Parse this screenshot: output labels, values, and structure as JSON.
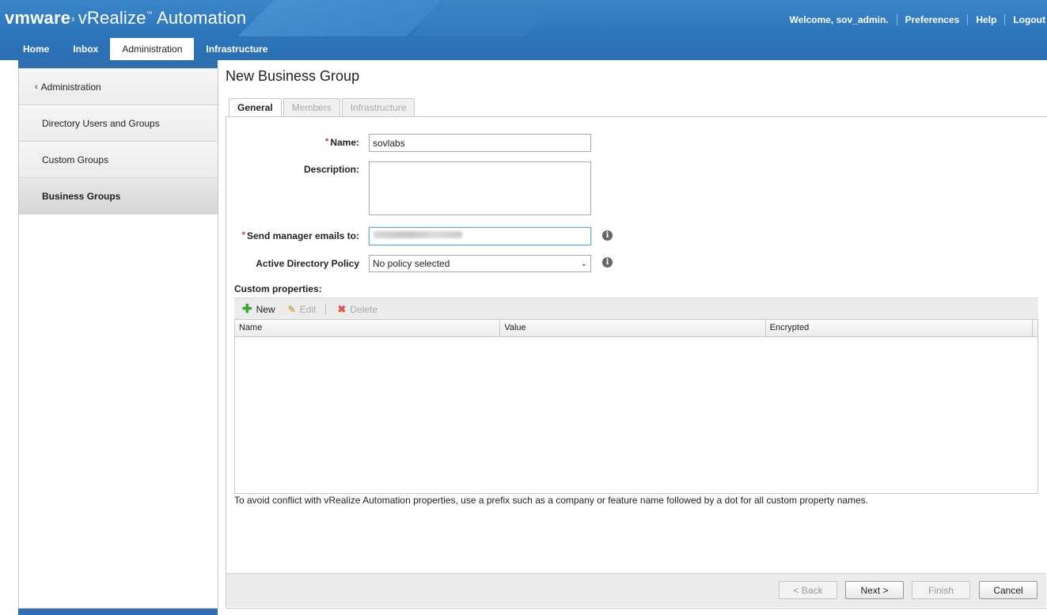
{
  "header": {
    "brand_vm": "vmware",
    "brand_product": "vRealize",
    "brand_tm": "™",
    "brand_product2": "Automation",
    "welcome": "Welcome, sov_admin.",
    "links": [
      "Preferences",
      "Help",
      "Logout"
    ]
  },
  "tabs": [
    "Home",
    "Inbox",
    "Administration",
    "Infrastructure"
  ],
  "active_tab": "Administration",
  "sidebar": {
    "back_label": "Administration",
    "items": [
      {
        "label": "Directory Users and Groups"
      },
      {
        "label": "Custom Groups"
      },
      {
        "label": "Business Groups"
      }
    ],
    "active": "Business Groups"
  },
  "page": {
    "title": "New Business Group",
    "wizard_tabs": [
      "General",
      "Members",
      "Infrastructure"
    ],
    "active_wizard_tab": "General"
  },
  "form": {
    "required_mark": "*",
    "name_label": "Name:",
    "name_value": "sovlabs",
    "description_label": "Description:",
    "description_value": "",
    "manager_label": "Send manager emails to:",
    "ad_policy_label": "Active Directory Policy",
    "ad_policy_value": "No policy selected"
  },
  "custom_properties": {
    "label": "Custom properties:",
    "toolbar": {
      "new": "New",
      "edit": "Edit",
      "delete": "Delete"
    },
    "columns": [
      "Name",
      "Value",
      "Encrypted"
    ],
    "rows": [],
    "note": "To avoid conflict with vRealize Automation properties, use a prefix such as a company or feature name followed by a dot for all custom property names."
  },
  "footer": {
    "back": "< Back",
    "next": "Next >",
    "finish": "Finish",
    "cancel": "Cancel"
  },
  "colors": {
    "header_blue": "#2c74b9",
    "required_red": "#c0392b",
    "add_green": "#3aa531",
    "delete_red": "#d9534f"
  }
}
